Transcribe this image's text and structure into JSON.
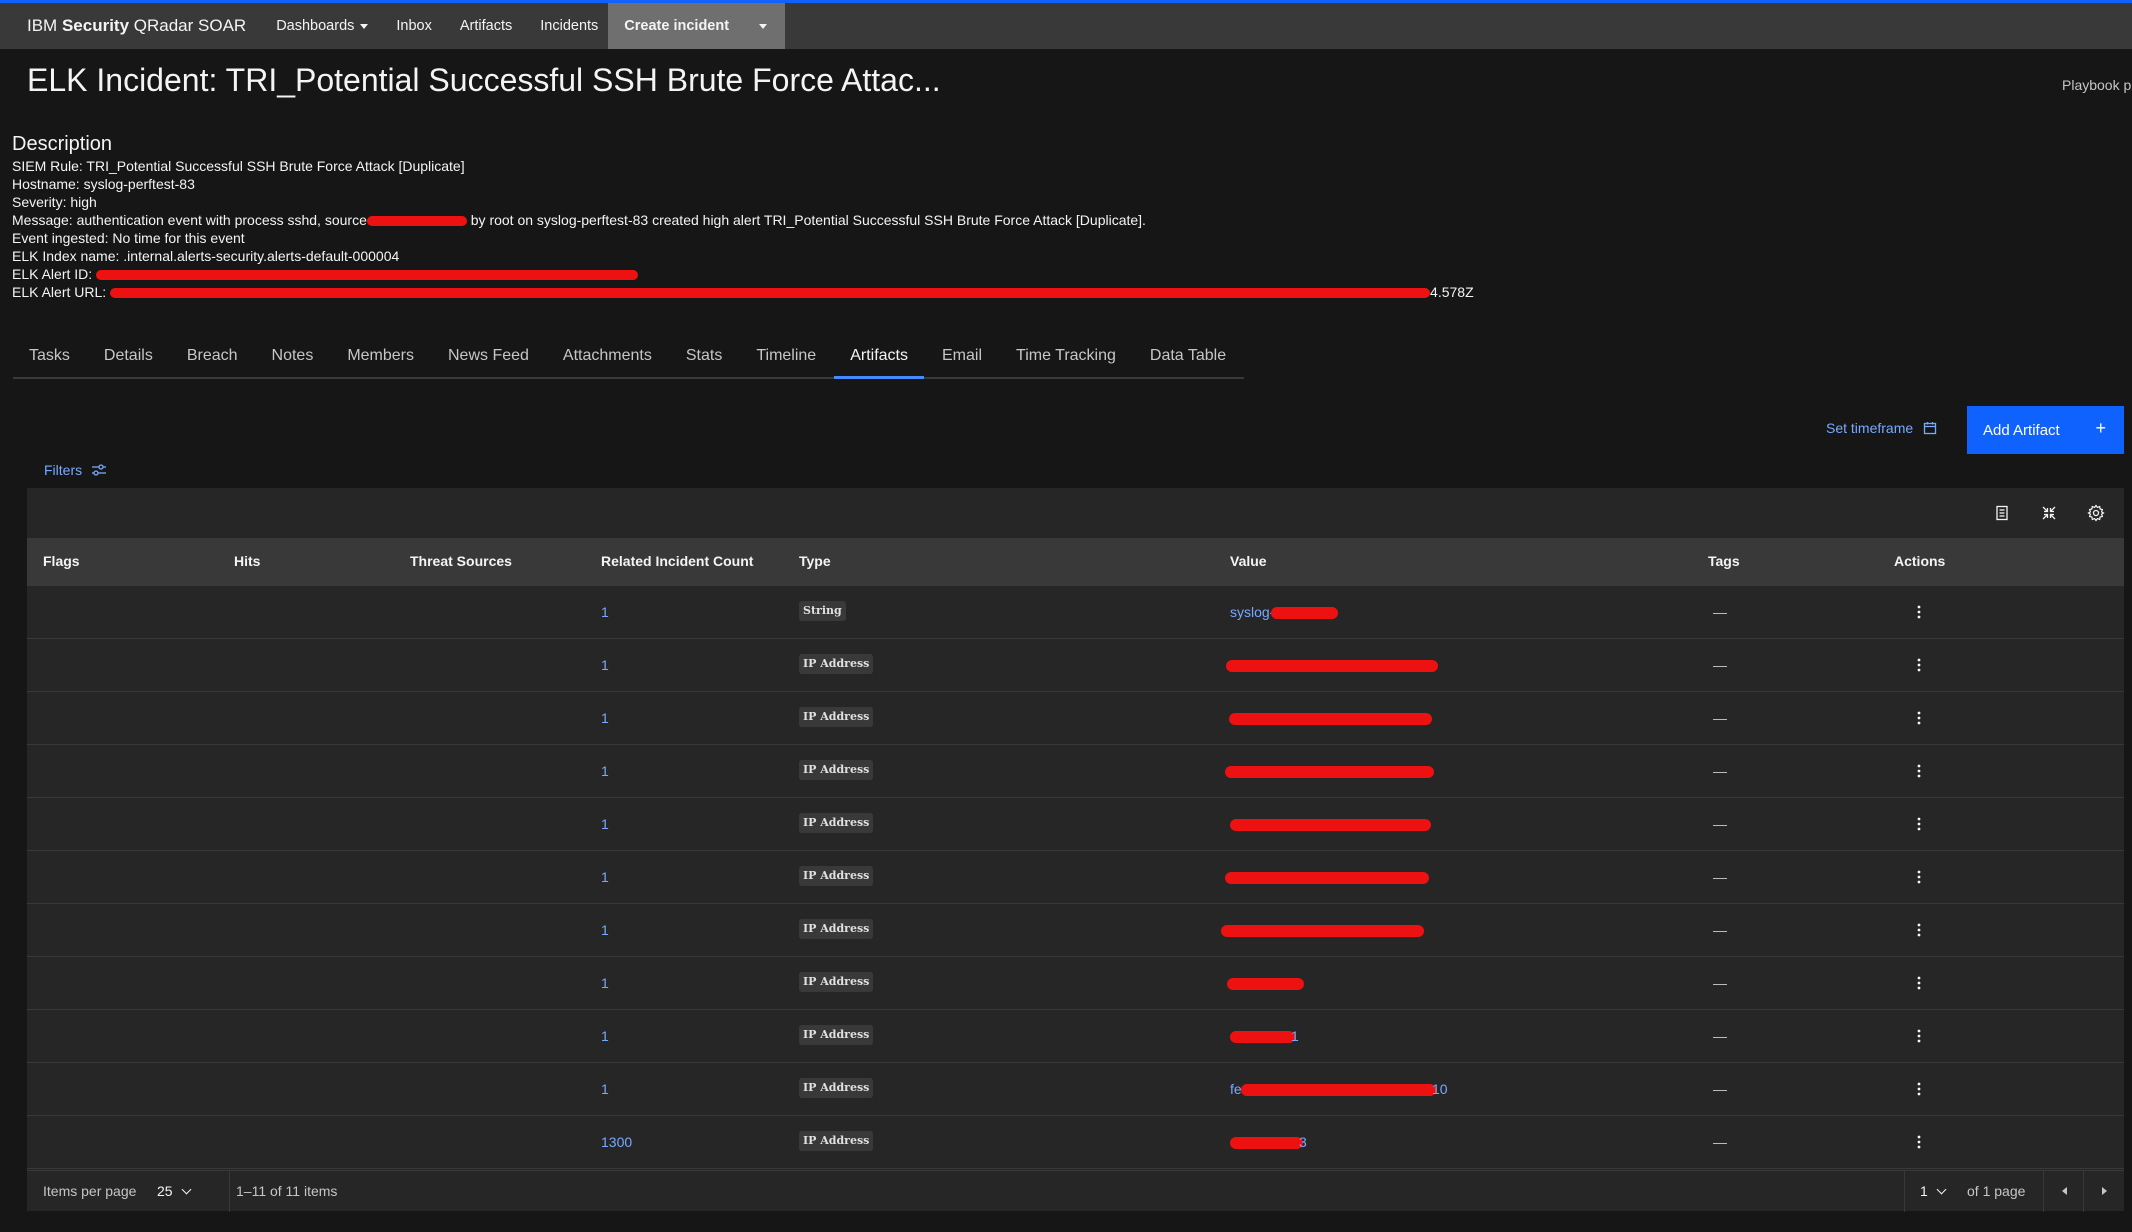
{
  "nav": {
    "brand_prefix": "IBM ",
    "brand_bold": "Security",
    "brand_suffix": " QRadar SOAR",
    "dashboards": "Dashboards",
    "inbox": "Inbox",
    "artifacts": "Artifacts",
    "incidents": "Incidents",
    "create_incident": "Create incident"
  },
  "header": {
    "title": "ELK Incident: TRI_Potential Successful SSH Brute Force Attac...",
    "playbook": "Playbook p"
  },
  "description": {
    "heading": "Description",
    "siem_rule": "SIEM Rule: TRI_Potential Successful SSH Brute Force Attack [Duplicate]",
    "hostname": "Hostname: syslog-perftest-83",
    "severity": "Severity: high",
    "message_a": "Message: authentication event with process sshd, source",
    "message_b": " by root on syslog-perftest-83 created high alert TRI_Potential Successful SSH Brute Force Attack [Duplicate].",
    "event_ingested": "Event ingested: No time for this event",
    "index_name": "ELK Index name: .internal.alerts-security.alerts-default-000004",
    "alert_id_label": "ELK Alert ID: ",
    "alert_url_label": "ELK Alert URL: ",
    "alert_url_tail": "4.578Z"
  },
  "tabs": [
    "Tasks",
    "Details",
    "Breach",
    "Notes",
    "Members",
    "News Feed",
    "Attachments",
    "Stats",
    "Timeline",
    "Artifacts",
    "Email",
    "Time Tracking",
    "Data Table"
  ],
  "active_tab": "Artifacts",
  "toolbar": {
    "set_timeframe": "Set timeframe",
    "add_artifact": "Add Artifact",
    "add_plus": "+",
    "filters": "Filters"
  },
  "table": {
    "columns": {
      "flags": "Flags",
      "hits": "Hits",
      "threat_sources": "Threat Sources",
      "related_count": "Related Incident Count",
      "type": "Type",
      "value": "Value",
      "tags": "Tags",
      "actions": "Actions"
    },
    "rows": [
      {
        "count": "1",
        "type": "String",
        "value_prefix": "syslog-",
        "value_suffix": "",
        "tags": "—"
      },
      {
        "count": "1",
        "type": "IP Address",
        "value_prefix": "",
        "value_suffix": "",
        "tags": "—"
      },
      {
        "count": "1",
        "type": "IP Address",
        "value_prefix": "",
        "value_suffix": "",
        "tags": "—"
      },
      {
        "count": "1",
        "type": "IP Address",
        "value_prefix": "",
        "value_suffix": "",
        "tags": "—"
      },
      {
        "count": "1",
        "type": "IP Address",
        "value_prefix": "",
        "value_suffix": "",
        "tags": "—"
      },
      {
        "count": "1",
        "type": "IP Address",
        "value_prefix": "",
        "value_suffix": "",
        "tags": "—"
      },
      {
        "count": "1",
        "type": "IP Address",
        "value_prefix": "",
        "value_suffix": "",
        "tags": "—"
      },
      {
        "count": "1",
        "type": "IP Address",
        "value_prefix": "",
        "value_suffix": "",
        "tags": "—"
      },
      {
        "count": "1",
        "type": "IP Address",
        "value_prefix": "",
        "value_suffix": "1",
        "tags": "—"
      },
      {
        "count": "1",
        "type": "IP Address",
        "value_prefix": "fe",
        "value_suffix": "10",
        "tags": "—"
      },
      {
        "count": "1300",
        "type": "IP Address",
        "value_prefix": "",
        "value_suffix": "3",
        "tags": "—"
      }
    ]
  },
  "pagination": {
    "items_per_page_label": "Items per page",
    "items_per_page": "25",
    "range": "1–11 of 11 items",
    "page": "1",
    "of_pages": "of 1 page"
  },
  "icons": {
    "calendar": "calendar-icon",
    "filter": "filter-sliders-icon",
    "export": "export-icon",
    "collapse": "collapse-icon",
    "settings": "gear-icon",
    "overflow": "overflow-menu-icon"
  },
  "colors": {
    "primary": "#0f62fe",
    "link": "#78a9ff",
    "redaction": "#ee1111",
    "nav_bg": "#393939",
    "page_bg": "#161616",
    "table_bg": "#262626"
  }
}
